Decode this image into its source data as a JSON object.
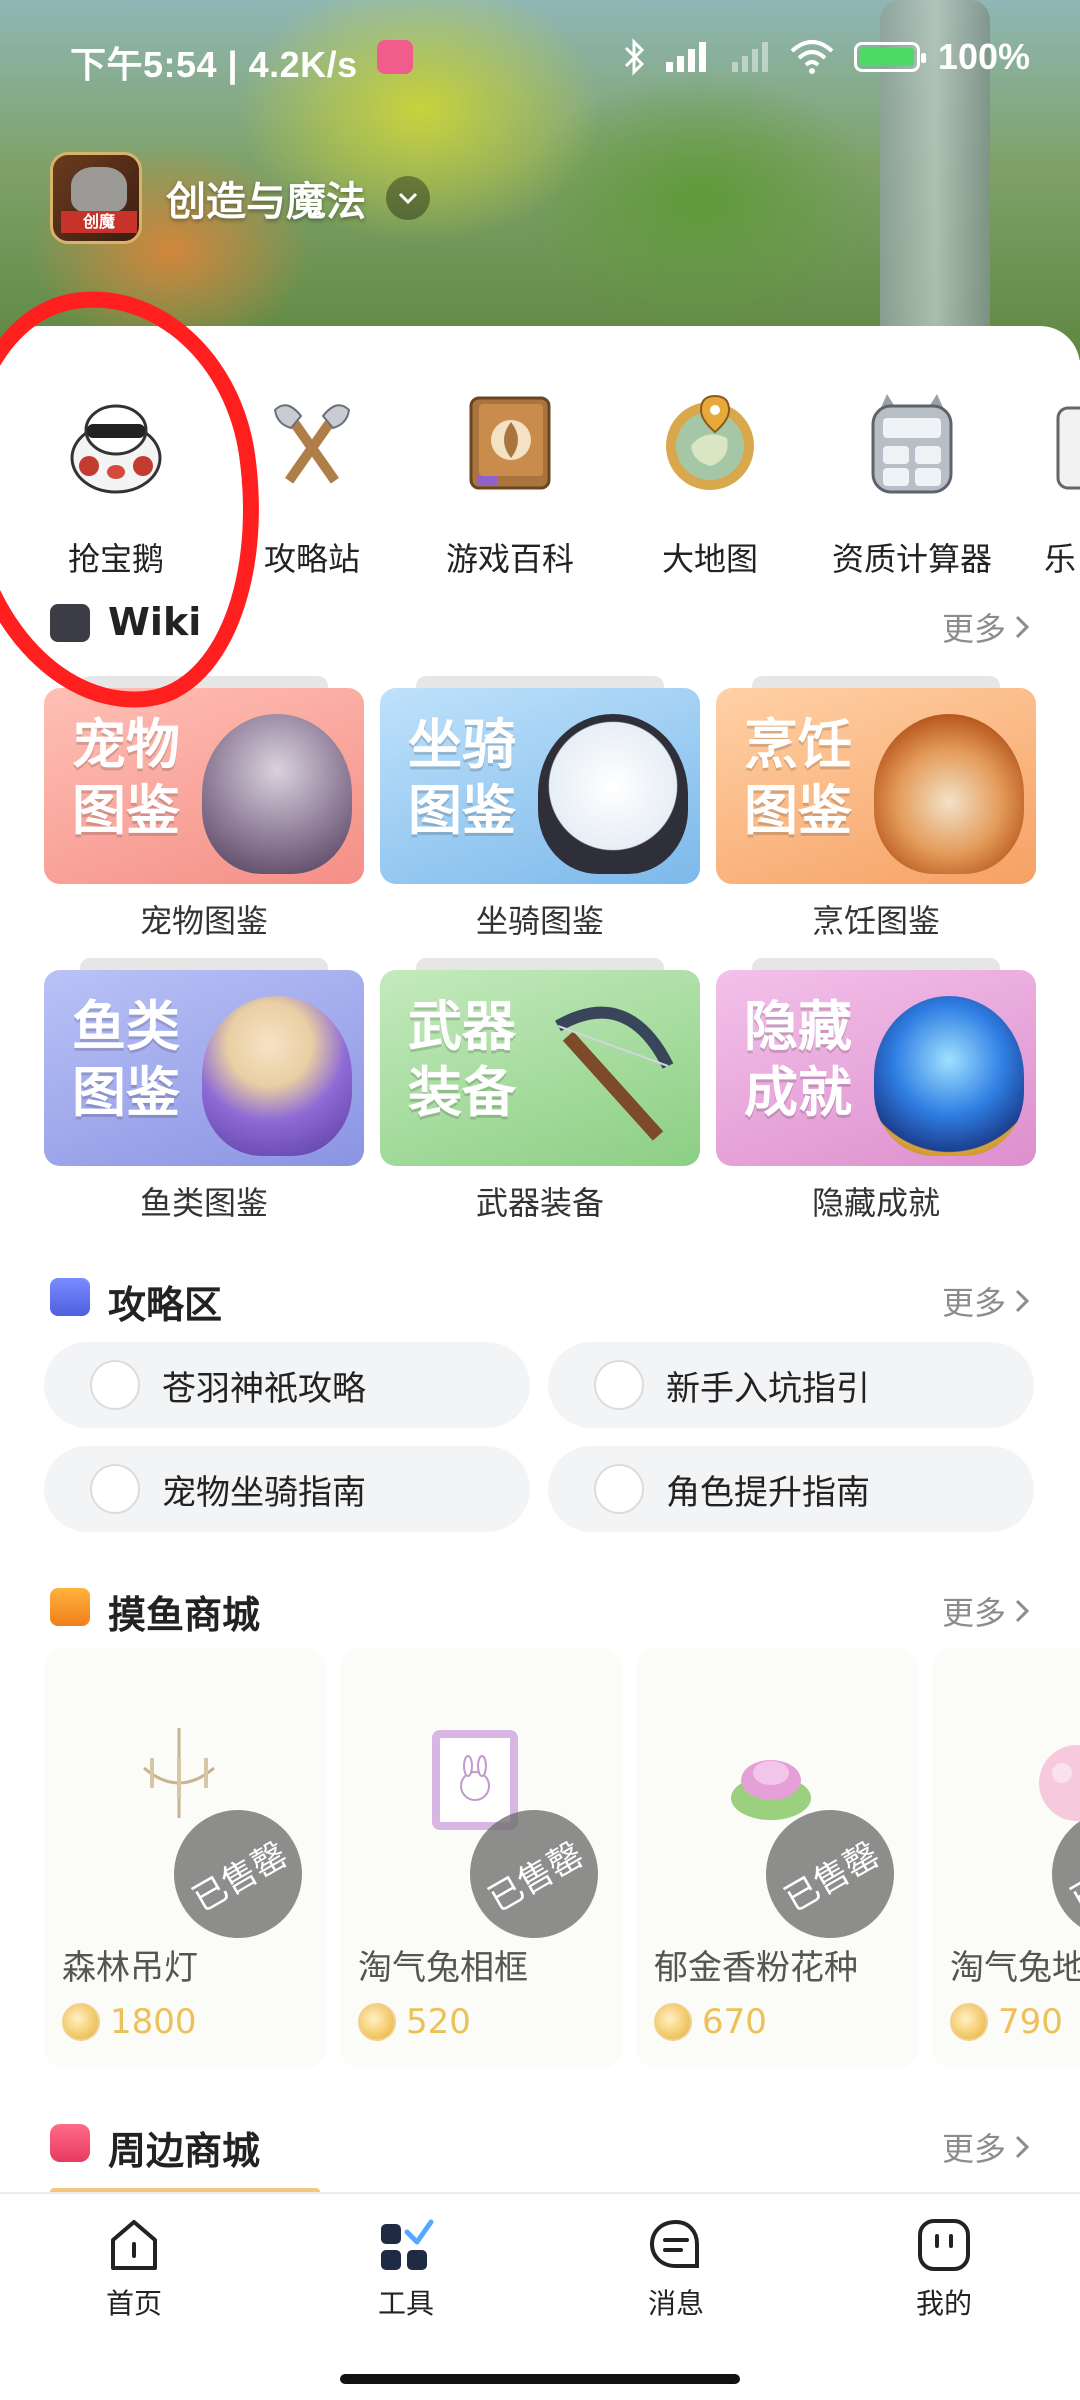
{
  "status_bar": {
    "time": "下午5:54 | 4.2K/s",
    "battery": "100%"
  },
  "game": {
    "title": "创造与魔法"
  },
  "tools": [
    {
      "label": "抢宝鹅",
      "icon": "penguin-icon"
    },
    {
      "label": "攻略站",
      "icon": "axes-icon"
    },
    {
      "label": "游戏百科",
      "icon": "book-icon"
    },
    {
      "label": "大地图",
      "icon": "map-icon"
    },
    {
      "label": "资质计算器",
      "icon": "calculator-icon"
    },
    {
      "label": "乐",
      "icon": "partial-icon"
    }
  ],
  "wiki": {
    "title": "Wiki",
    "more": "更多",
    "items": [
      {
        "label": "宠物图鉴",
        "card_text": "宠物图鉴",
        "color": "#f6a49b"
      },
      {
        "label": "坐骑图鉴",
        "card_text": "坐骑图鉴",
        "color": "#8fc7f0"
      },
      {
        "label": "烹饪图鉴",
        "card_text": "烹饪图鉴",
        "color": "#f6b47c"
      },
      {
        "label": "鱼类图鉴",
        "card_text": "鱼类图鉴",
        "color": "#9aa6ea"
      },
      {
        "label": "武器装备",
        "card_text": "武器装备",
        "color": "#9ed696"
      },
      {
        "label": "隐藏成就",
        "card_text": "隐藏成就",
        "color": "#e6a4d6"
      }
    ]
  },
  "strategy": {
    "title": "攻略区",
    "more": "更多",
    "items": [
      {
        "label": "苍羽神祇攻略"
      },
      {
        "label": "新手入坑指引"
      },
      {
        "label": "宠物坐骑指南"
      },
      {
        "label": "角色提升指南"
      }
    ]
  },
  "shop": {
    "title": "摸鱼商城",
    "more": "更多",
    "sold_out": "已售罄",
    "items": [
      {
        "name": "森林吊灯",
        "price": "1800"
      },
      {
        "name": "淘气兔相框",
        "price": "520"
      },
      {
        "name": "郁金香粉花种",
        "price": "670"
      },
      {
        "name": "淘气兔地",
        "price": "790"
      }
    ]
  },
  "merch": {
    "title": "周边商城",
    "more": "更多"
  },
  "nav": [
    {
      "label": "首页",
      "icon": "home-icon"
    },
    {
      "label": "工具",
      "icon": "tools-icon"
    },
    {
      "label": "消息",
      "icon": "message-icon"
    },
    {
      "label": "我的",
      "icon": "profile-icon"
    }
  ],
  "colors": {
    "annotation": "#ff1f1f",
    "accent": "#2f6bff",
    "coin": "#ecc15a"
  }
}
